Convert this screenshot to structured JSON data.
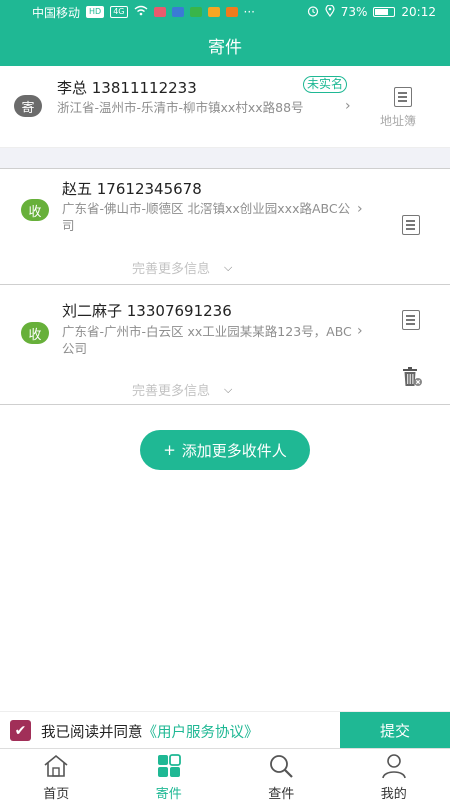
{
  "status_bar": {
    "carrier": "中国移动",
    "hd": "HD",
    "signal": "4G",
    "battery": "73%",
    "battery_level": 0.73,
    "time": "20:12",
    "more": "···"
  },
  "header": {
    "title": "寄件"
  },
  "sender": {
    "badge": "寄",
    "name_phone": "李总 13811112233",
    "tag": "未实名",
    "address": "浙江省-温州市-乐清市-柳市镇xx村xx路88号",
    "address_book_label": "地址簿"
  },
  "receivers": [
    {
      "badge": "收",
      "name_phone": "赵五 17612345678",
      "address": "广东省-佛山市-顺德区 北滘镇xx创业园xxx路ABC公司",
      "more_info": "完善更多信息"
    },
    {
      "badge": "收",
      "name_phone": "刘二麻子 13307691236",
      "address": "广东省-广州市-白云区 xx工业园某某路123号，ABC公司",
      "more_info": "完善更多信息"
    }
  ],
  "add_button": {
    "icon": "+",
    "label": "添加更多收件人"
  },
  "agreement": {
    "checked": true,
    "prefix": "我已阅读并同意",
    "link": "《用户服务协议》"
  },
  "submit": {
    "label": "提交"
  },
  "tabs": [
    {
      "label": "首页",
      "icon": "home-icon",
      "active": false
    },
    {
      "label": "寄件",
      "icon": "grid-icon",
      "active": true
    },
    {
      "label": "查件",
      "icon": "search-icon",
      "active": false
    },
    {
      "label": "我的",
      "icon": "person-icon",
      "active": false
    }
  ],
  "colors": {
    "accent": "#1fb894",
    "sender_badge": "#6b6b6b",
    "receiver_badge": "#67b03a",
    "checkbox": "#a12f58"
  }
}
